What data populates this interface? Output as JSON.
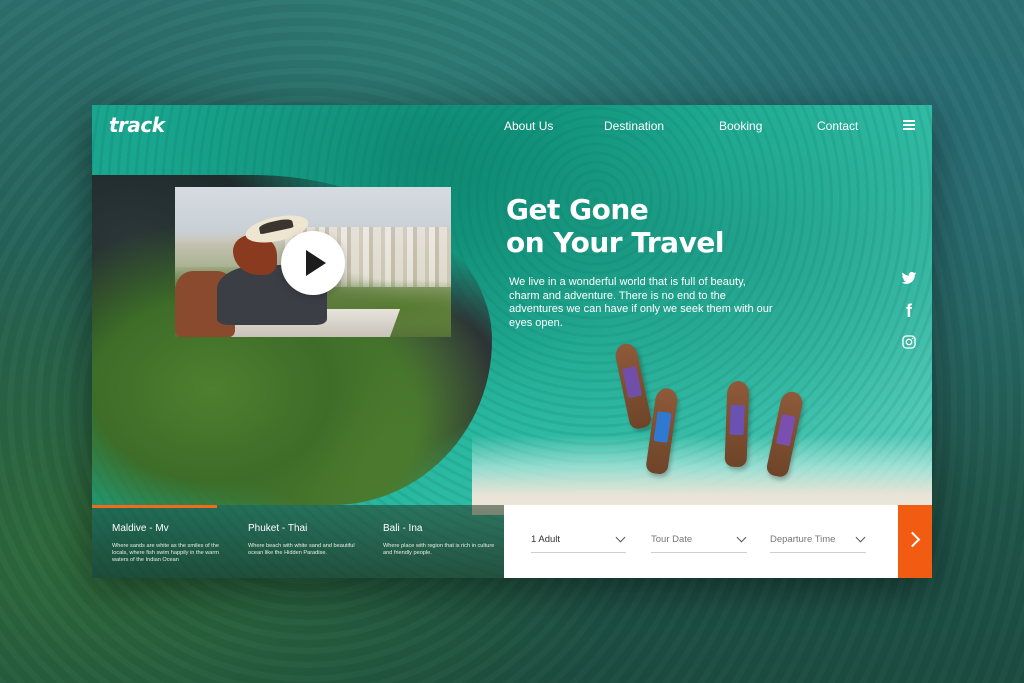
{
  "brand": {
    "logo_text": "track"
  },
  "nav": {
    "items": [
      {
        "label": "About Us"
      },
      {
        "label": "Destination"
      },
      {
        "label": "Booking"
      },
      {
        "label": "Contact"
      }
    ],
    "menu_icon": "hamburger-menu-icon"
  },
  "hero": {
    "title_line1": "Get Gone",
    "title_line2": "on Your Travel",
    "description": "We live in a wonderful world that is full of beauty, charm and adventure. There is no end to the adventures we can have if only we seek them with our eyes open."
  },
  "video": {
    "play_icon": "play-icon"
  },
  "social": [
    {
      "icon": "twitter-icon"
    },
    {
      "icon": "facebook-icon",
      "glyph": "f"
    },
    {
      "icon": "instagram-icon"
    }
  ],
  "destinations": [
    {
      "name": "Maldive - Mv",
      "desc": "Where sands are white as the smiles of the locals, where fish swim happily in the warm waters of the Indian Ocean"
    },
    {
      "name": "Phuket - Thai",
      "desc": "Where beach with white sand and beautiful ocean like the Hidden Paradise."
    },
    {
      "name": "Bali - Ina",
      "desc": "Where place with region that is rich in culture and friendly people."
    }
  ],
  "booking": {
    "guests_value": "1 Adult",
    "tour_date_placeholder": "Tour Date",
    "departure_placeholder": "Departure Time",
    "submit_icon": "chevron-right-icon"
  },
  "colors": {
    "accent": "#f25c12",
    "sea": "#1aa58f",
    "white": "#ffffff"
  }
}
